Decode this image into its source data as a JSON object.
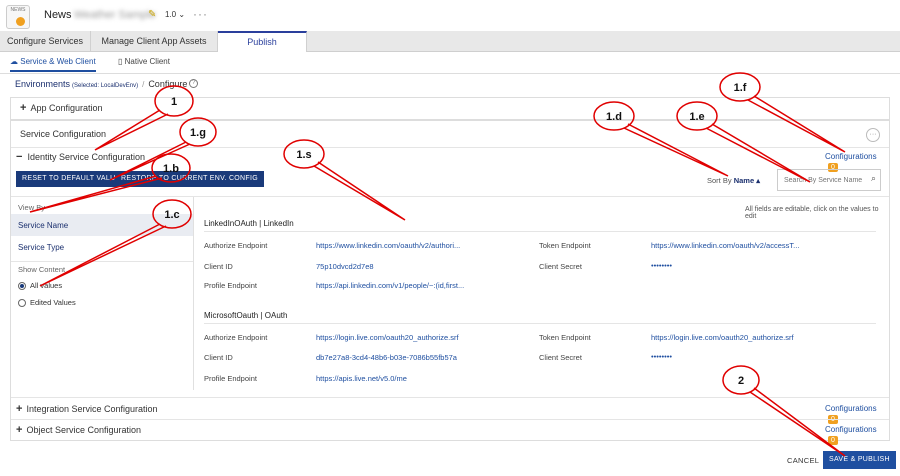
{
  "app": {
    "name": "News",
    "name_blurred": "Weather Sample",
    "version": "1.0 ⌄",
    "more": "···",
    "icon_text": "NEWS"
  },
  "tabs": [
    {
      "label": "Configure Services"
    },
    {
      "label": "Manage Client App Assets"
    },
    {
      "label": "Publish"
    }
  ],
  "subtabs": [
    {
      "label": "Service & Web Client"
    },
    {
      "label": "Native Client"
    }
  ],
  "breadcrumb": {
    "env": "Environments",
    "selected": "(Selected: LocalDevEnv)",
    "sep": "/",
    "current": "Configure",
    "help": "?"
  },
  "sections": {
    "app_config": "App Configuration",
    "service_config": "Service Configuration",
    "identity": "Identity Service Configuration",
    "integration": "Integration Service Configuration",
    "object": "Object Service Configuration",
    "configurations_label": "Configurations",
    "identity_count": "0",
    "integration_count": "0",
    "object_count": "0",
    "overflow": "···"
  },
  "buttons": {
    "reset": "RESET TO DEFAULT VALUE",
    "restore": "RESTORE TO CURRENT ENV. CONFIG",
    "cancel": "CANCEL",
    "save_publish": "SAVE & PUBLISH"
  },
  "sort": {
    "label": "Sort By",
    "value": "Name ▴"
  },
  "search": {
    "placeholder": "Search By Service Name"
  },
  "hint": "All fields are editable, click on the values to edit",
  "left_nav": {
    "view_by": "View By",
    "service_name": "Service Name",
    "service_type": "Service Type",
    "show_content": "Show Content",
    "all_values": "All values",
    "edited_values": "Edited Values"
  },
  "providers": [
    {
      "title": "LinkedInOAuth | LinkedIn",
      "authorize_label": "Authorize Endpoint",
      "authorize_value": "https://www.linkedin.com/oauth/v2/authori...",
      "token_label": "Token Endpoint",
      "token_value": "https://www.linkedin.com/oauth/v2/accessT...",
      "client_id_label": "Client ID",
      "client_id_value": "75p10dvcd2d7e8",
      "secret_label": "Client Secret",
      "secret_value": "••••••••",
      "profile_label": "Profile Endpoint",
      "profile_value": "https://api.linkedin.com/v1/people/~:(id,first..."
    },
    {
      "title": "MicrosoftOauth | OAuth",
      "authorize_label": "Authorize Endpoint",
      "authorize_value": "https://login.live.com/oauth20_authorize.srf",
      "token_label": "Token Endpoint",
      "token_value": "https://login.live.com/oauth20_authorize.srf",
      "client_id_label": "Client ID",
      "client_id_value": "db7e27a8-3cd4-48b6-b03e-7086b55fb57a",
      "secret_label": "Client Secret",
      "secret_value": "••••••••",
      "profile_label": "Profile Endpoint",
      "profile_value": "https://apis.live.net/v5.0/me"
    }
  ],
  "annotations": {
    "a1": "1",
    "a1g": "1.g",
    "a1b": "1.b",
    "a1c": "1.c",
    "a1s": "1.s",
    "a1d": "1.d",
    "a1e": "1.e",
    "a1f": "1.f",
    "a2": "2"
  },
  "colors": {
    "brand": "#1a3a7a",
    "accent": "#f0a020",
    "link": "#1f4fa0",
    "annotation": "#e00000"
  }
}
